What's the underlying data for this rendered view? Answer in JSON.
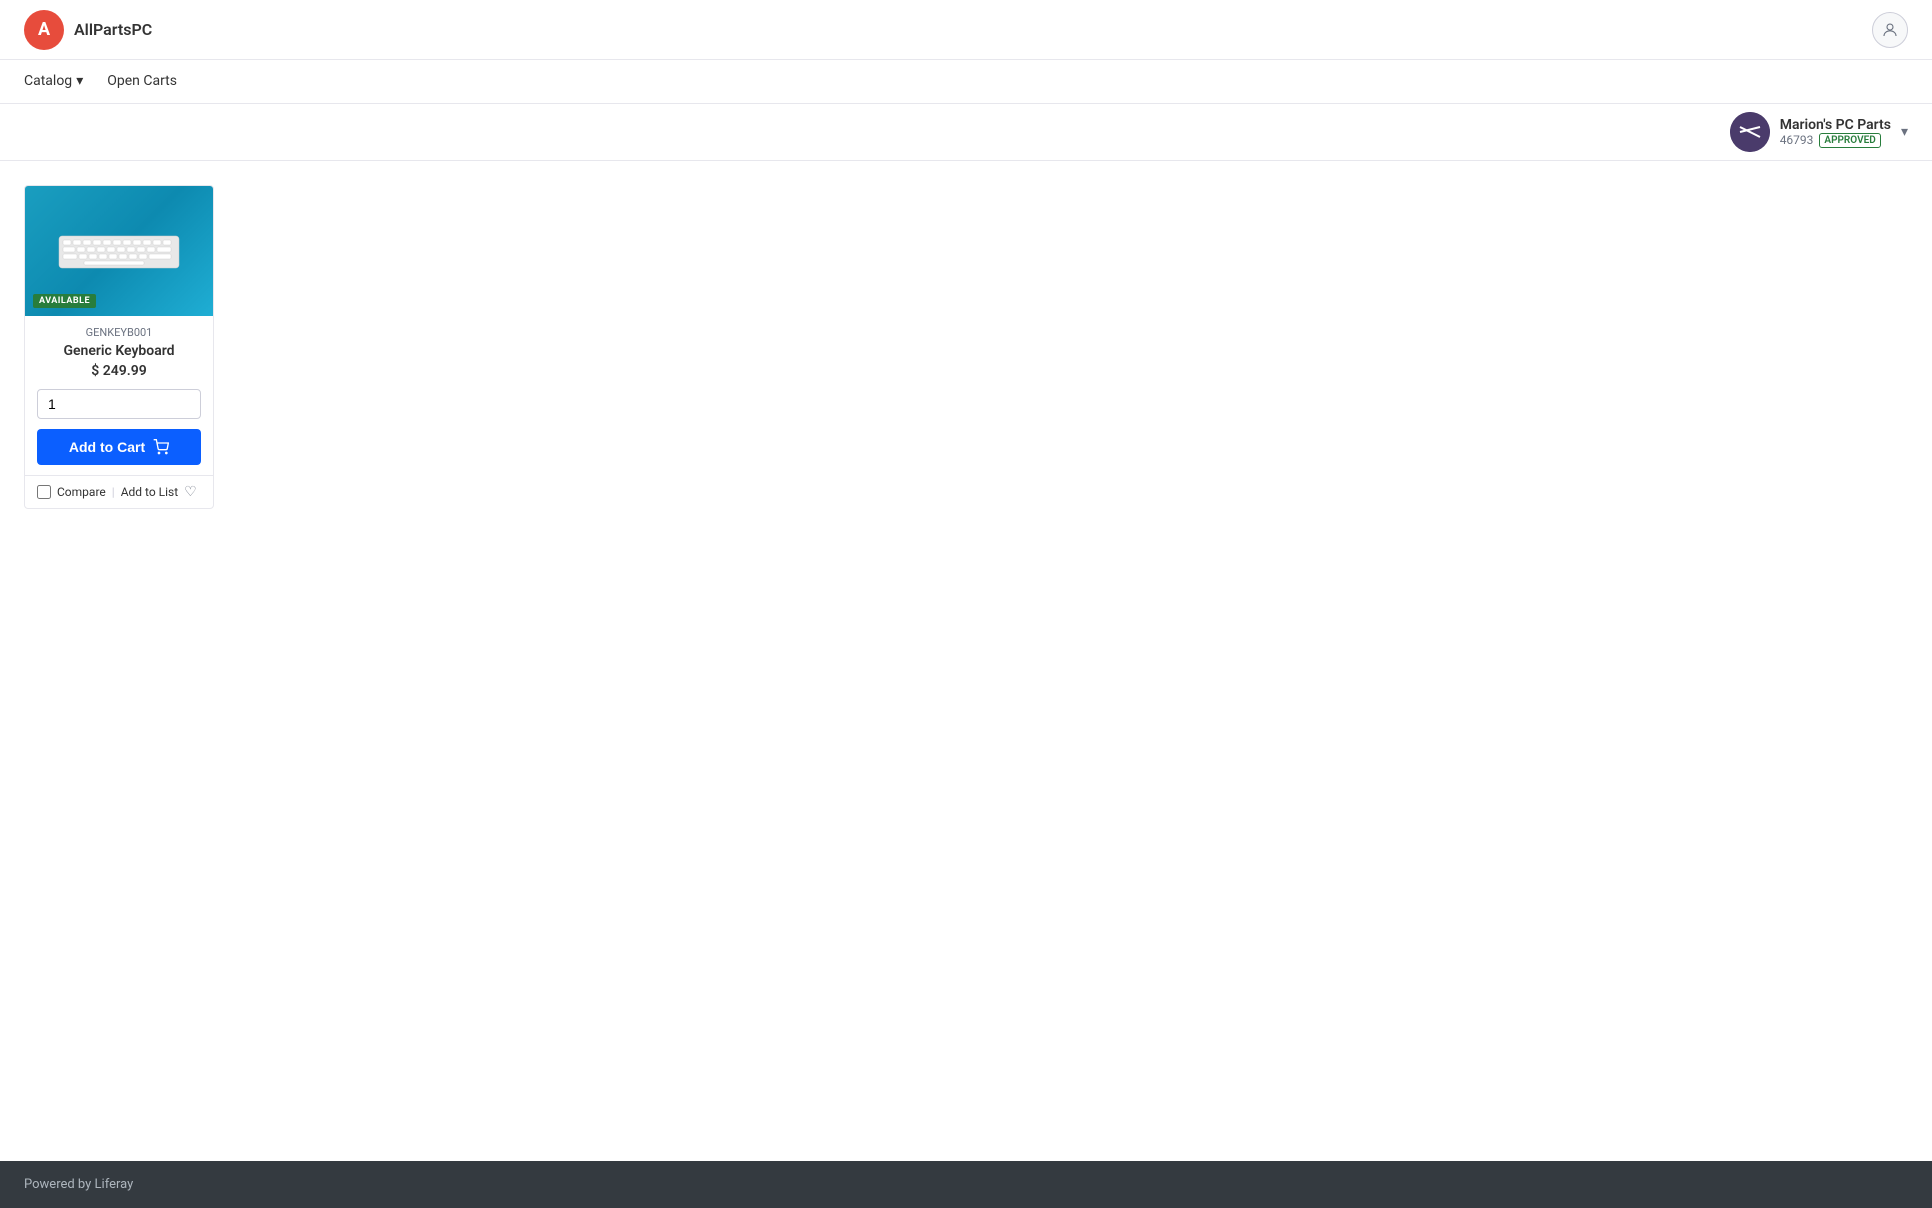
{
  "site": {
    "logo_letter": "A",
    "name": "AllPartsPC"
  },
  "nav": {
    "catalog_label": "Catalog",
    "open_carts_label": "Open Carts"
  },
  "account": {
    "name": "Marion's PC Parts",
    "id": "46793",
    "status": "APPROVED"
  },
  "product": {
    "sku": "GENKEYB001",
    "name": "Generic Keyboard",
    "price": "$ 249.99",
    "availability": "AVAILABLE",
    "quantity": "1",
    "add_to_cart_label": "Add to Cart",
    "compare_label": "Compare",
    "add_to_list_label": "Add to List"
  },
  "footer": {
    "powered_by": "Powered by Liferay"
  }
}
